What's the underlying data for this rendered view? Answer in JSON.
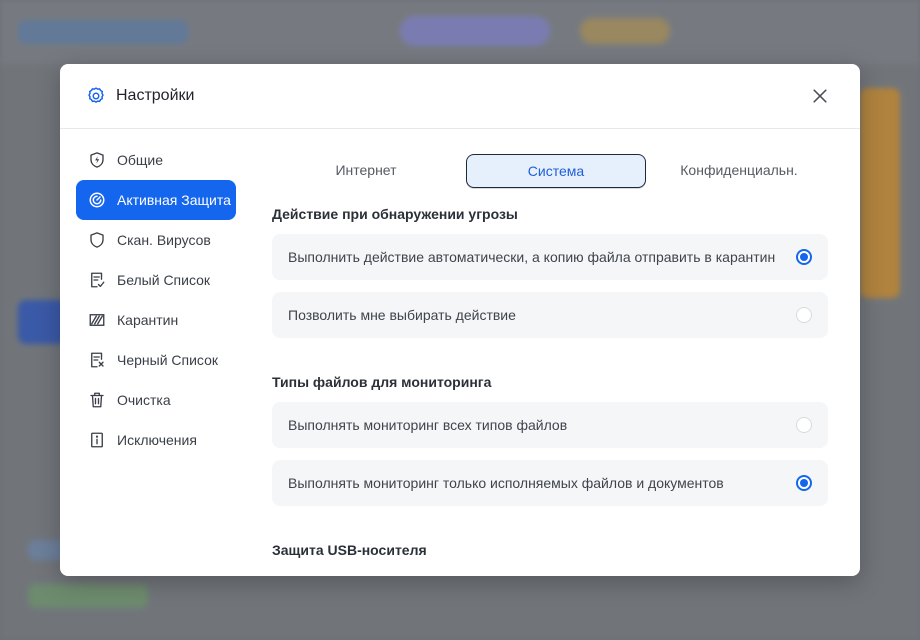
{
  "dialog": {
    "title": "Настройки",
    "gear_icon": "gear-icon",
    "close_icon": "close-icon"
  },
  "sidebar": {
    "items": [
      {
        "label": "Общие",
        "icon": "lightning-shield-icon",
        "active": false
      },
      {
        "label": "Активная Защита",
        "icon": "radar-icon",
        "active": true
      },
      {
        "label": "Скан. Вирусов",
        "icon": "shield-icon",
        "active": false
      },
      {
        "label": "Белый Список",
        "icon": "checklist-icon",
        "active": false
      },
      {
        "label": "Карантин",
        "icon": "quarantine-icon",
        "active": false
      },
      {
        "label": "Черный Список",
        "icon": "blacklist-icon",
        "active": false
      },
      {
        "label": "Очистка",
        "icon": "trash-icon",
        "active": false
      },
      {
        "label": "Исключения",
        "icon": "info-doc-icon",
        "active": false
      }
    ]
  },
  "tabs": [
    {
      "label": "Интернет",
      "active": false
    },
    {
      "label": "Система",
      "active": true
    },
    {
      "label": "Конфиденциальн.",
      "active": false
    }
  ],
  "sections": {
    "threat": {
      "title": "Действие при обнаружении угрозы",
      "options": [
        {
          "label": "Выполнить действие автоматически, а копию файла отправить в карантин",
          "selected": true
        },
        {
          "label": "Позволить мне выбирать действие",
          "selected": false
        }
      ]
    },
    "filetypes": {
      "title": "Типы файлов для мониторинга",
      "options": [
        {
          "label": "Выполнять мониторинг всех типов файлов",
          "selected": false
        },
        {
          "label": "Выполнять мониторинг только исполняемых файлов и документов",
          "selected": true
        }
      ]
    },
    "usb": {
      "title": "Защита USB-носителя"
    }
  },
  "colors": {
    "accent": "#1566ee",
    "active_tab_bg": "#e6f0fd",
    "option_bg": "#f5f6f8"
  }
}
